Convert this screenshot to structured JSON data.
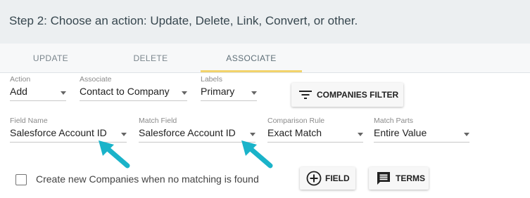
{
  "header": {
    "title": "Step 2: Choose an action: Update, Delete, Link, Convert, or other."
  },
  "tabs": [
    {
      "label": "UPDATE"
    },
    {
      "label": "DELETE"
    },
    {
      "label": "ASSOCIATE",
      "active": true
    }
  ],
  "row1": {
    "action": {
      "label": "Action",
      "value": "Add"
    },
    "associate": {
      "label": "Associate",
      "value": "Contact to Company"
    },
    "labels": {
      "label": "Labels",
      "value": "Primary"
    },
    "companies_filter_button": {
      "label": "COMPANIES FILTER",
      "icon": "filter-icon"
    }
  },
  "row2": {
    "field_name": {
      "label": "Field Name",
      "value": "Salesforce Account ID"
    },
    "match_field": {
      "label": "Match Field",
      "value": "Salesforce Account ID"
    },
    "comparison_rule": {
      "label": "Comparison Rule",
      "value": "Exact Match"
    },
    "match_parts": {
      "label": "Match Parts",
      "value": "Entire Value"
    }
  },
  "footer": {
    "create_new_checkbox": {
      "label": "Create new Companies when no matching is found",
      "checked": false
    },
    "field_button": {
      "label": "FIELD",
      "icon": "add-circle-icon"
    },
    "terms_button": {
      "label": "TERMS",
      "icon": "comment-icon"
    }
  },
  "colors": {
    "header_bg": "#eceff1",
    "tab_indicator": "#f2d36b",
    "annotation_arrow": "#1ab3c9"
  }
}
